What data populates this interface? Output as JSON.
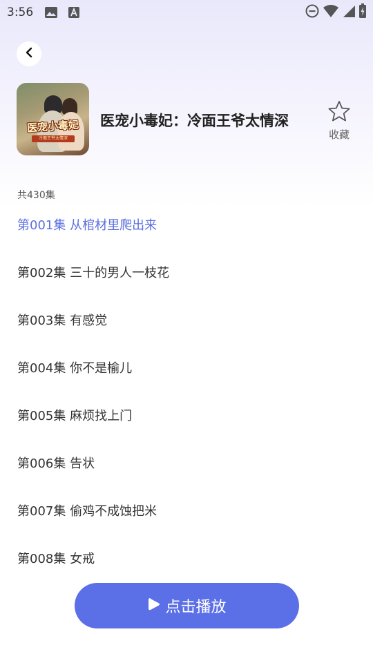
{
  "status_bar": {
    "time": "3:56"
  },
  "drama": {
    "title": "医宠小毒妃：冷面王爷太情深",
    "cover_title": "医宠小毒妃",
    "cover_subtitle": "冷面王爷太情深"
  },
  "favorite": {
    "label": "收藏"
  },
  "episode_count": "共430集",
  "episodes": [
    {
      "label": "第001集 从棺材里爬出来",
      "active": true
    },
    {
      "label": "第002集 三十的男人一枝花",
      "active": false
    },
    {
      "label": "第003集 有感觉",
      "active": false
    },
    {
      "label": "第004集 你不是榆儿",
      "active": false
    },
    {
      "label": "第005集 麻烦找上门",
      "active": false
    },
    {
      "label": "第006集 告状",
      "active": false
    },
    {
      "label": "第007集 偷鸡不成蚀把米",
      "active": false
    },
    {
      "label": "第008集 女戒",
      "active": false
    }
  ],
  "play_button": {
    "label": "点击播放"
  },
  "colors": {
    "accent": "#5b6fe6",
    "active_episode": "#5b6fe0"
  }
}
